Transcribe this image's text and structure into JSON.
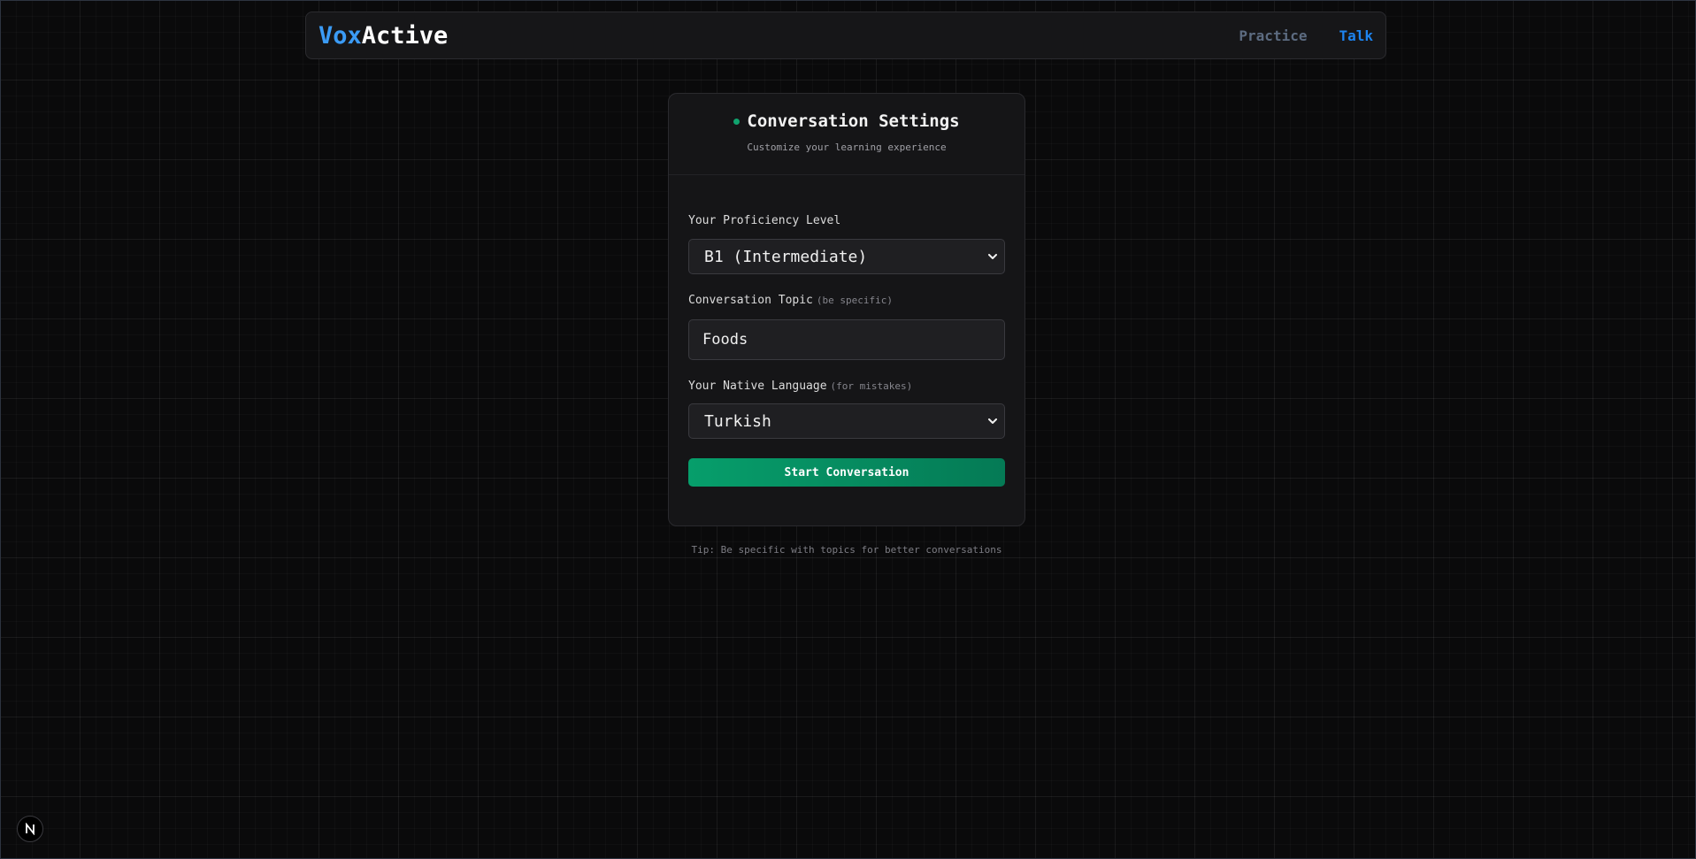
{
  "header": {
    "logo_part1": "Vox",
    "logo_part2": "Active",
    "nav": [
      {
        "label": "Practice",
        "active": false
      },
      {
        "label": "Talk",
        "active": true
      }
    ]
  },
  "card": {
    "title": "Conversation Settings",
    "subtitle": "Customize your learning experience",
    "proficiency": {
      "label": "Your Proficiency Level",
      "value": "B1 (Intermediate)"
    },
    "topic": {
      "label": "Conversation Topic",
      "hint": "(be specific)",
      "value": "Foods"
    },
    "native_language": {
      "label": "Your Native Language",
      "hint": "(for mistakes)",
      "value": "Turkish"
    },
    "start_button": "Start Conversation"
  },
  "tip": "Tip: Be specific with topics for better conversations",
  "badge": {
    "icon": "nextjs-logo-icon"
  },
  "colors": {
    "accent_blue": "#3b9bf5",
    "nav_active": "#1d84f0",
    "nav_inactive": "#5c6b80",
    "start_green": "#069e6b",
    "status_dot": "#10a36e",
    "background": "#0a0a0b"
  }
}
